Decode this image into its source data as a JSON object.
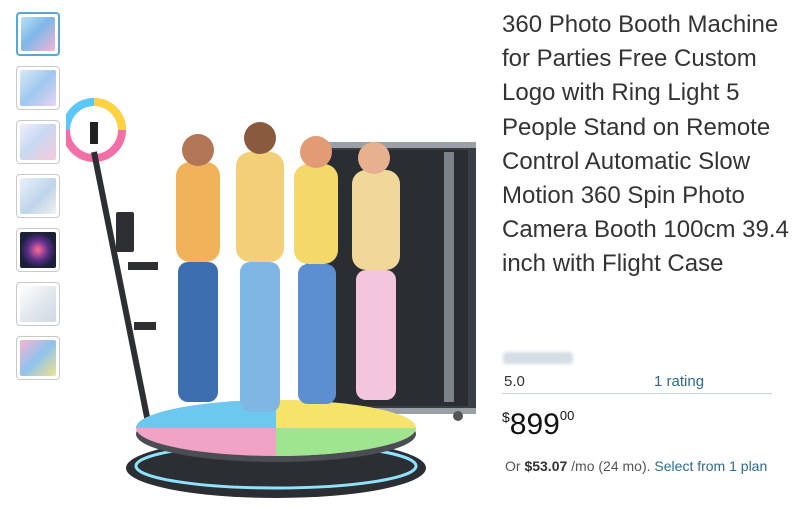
{
  "product": {
    "title": "360 Photo Booth Machine for Parties Free Custom Logo with Ring Light 5 People Stand on Remote Control Automatic Slow Motion 360 Spin Photo Camera Booth 100cm 39.4 inch with Flight Case",
    "rating_score": "5.0",
    "rating_count": "1 rating",
    "price": {
      "symbol": "$",
      "whole": "899",
      "fraction": "00"
    },
    "finance": {
      "prefix": "Or",
      "amount": "$53.07",
      "term": "/mo (24 mo).",
      "link": "Select from 1 plan"
    }
  },
  "gallery": {
    "thumbnail_count": 7,
    "selected_index": 0
  },
  "colors": {
    "link": "#2c6b8f",
    "selected_thumb_border": "#5aa7d6"
  }
}
